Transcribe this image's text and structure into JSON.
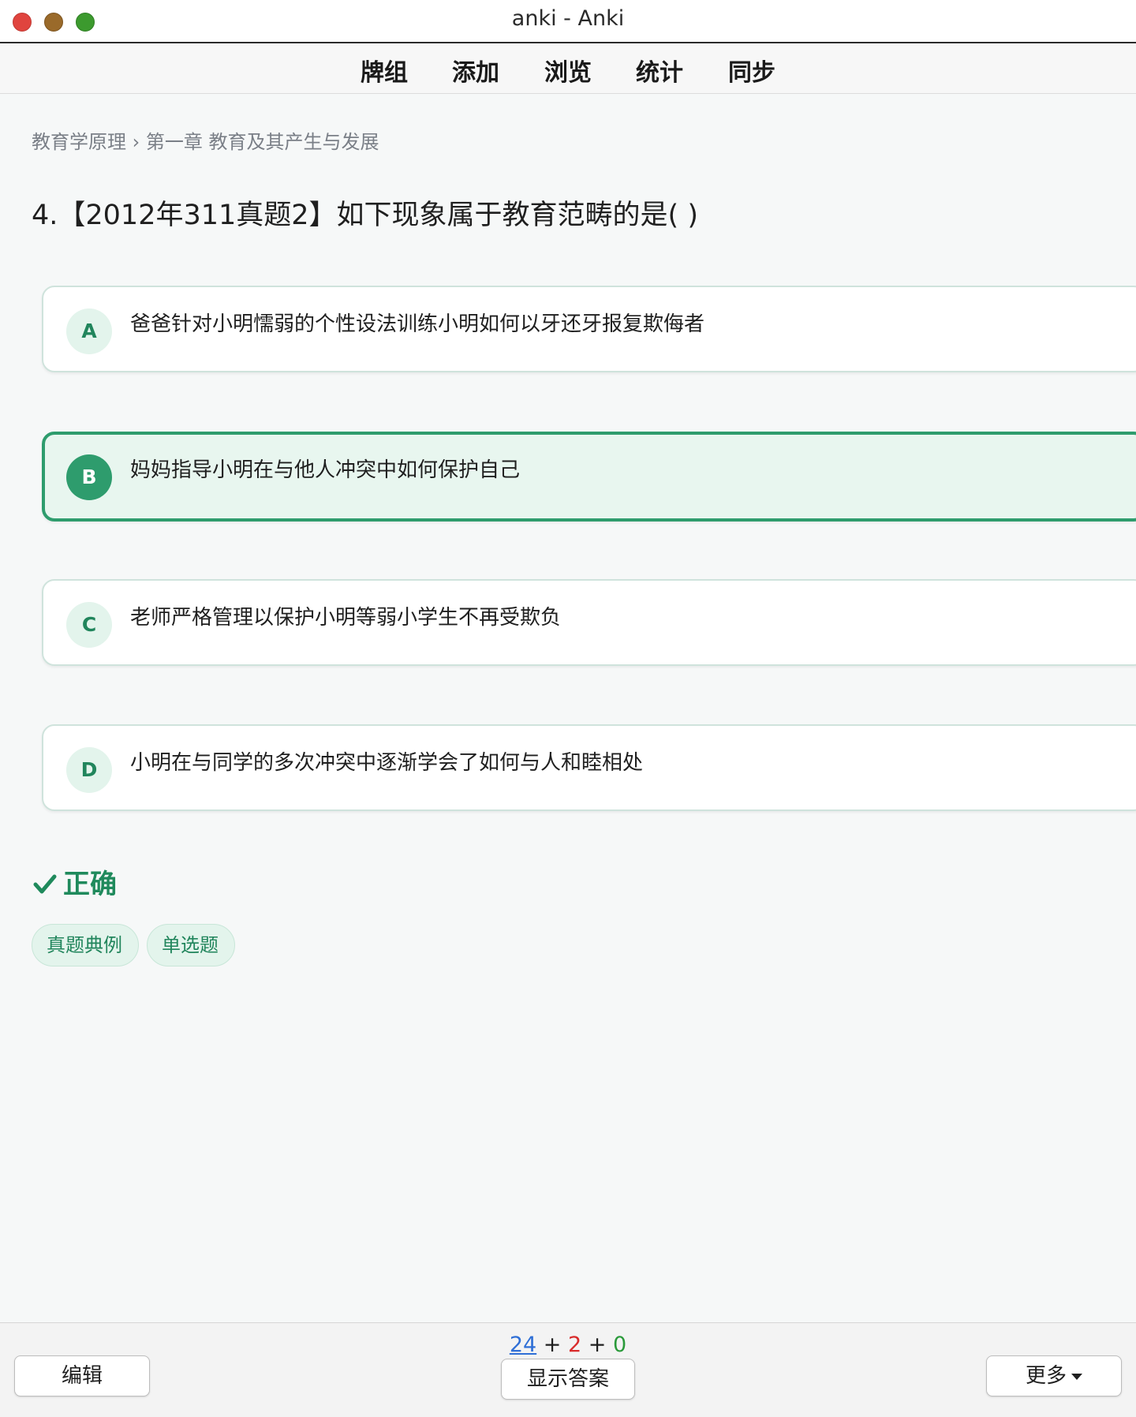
{
  "window": {
    "title": "anki - Anki"
  },
  "toolbar": {
    "decks": "牌组",
    "add": "添加",
    "browse": "浏览",
    "stats": "统计",
    "sync": "同步"
  },
  "card": {
    "breadcrumb": "教育学原理 › 第一章 教育及其产生与发展",
    "question": "4.【2012年311真题2】如下现象属于教育范畴的是( )",
    "options": [
      {
        "letter": "A",
        "text": "爸爸针对小明懦弱的个性设法训练小明如何以牙还牙报复欺侮者",
        "selected": false
      },
      {
        "letter": "B",
        "text": "妈妈指导小明在与他人冲突中如何保护自己",
        "selected": true
      },
      {
        "letter": "C",
        "text": "老师严格管理以保护小明等弱小学生不再受欺负",
        "selected": false
      },
      {
        "letter": "D",
        "text": "小明在与同学的多次冲突中逐渐学会了如何与人和睦相处",
        "selected": false
      }
    ],
    "result": "正确",
    "tags": [
      "真题典例",
      "单选题"
    ]
  },
  "bottom": {
    "edit": "编辑",
    "show_answer": "显示答案",
    "more": "更多",
    "counts": {
      "new": "24",
      "learn": "2",
      "review": "0",
      "sep": "+"
    }
  },
  "colors": {
    "accent": "#2e9c6d",
    "new": "#2f6fd6",
    "learn": "#d92b2b",
    "review": "#2a9a3a"
  }
}
